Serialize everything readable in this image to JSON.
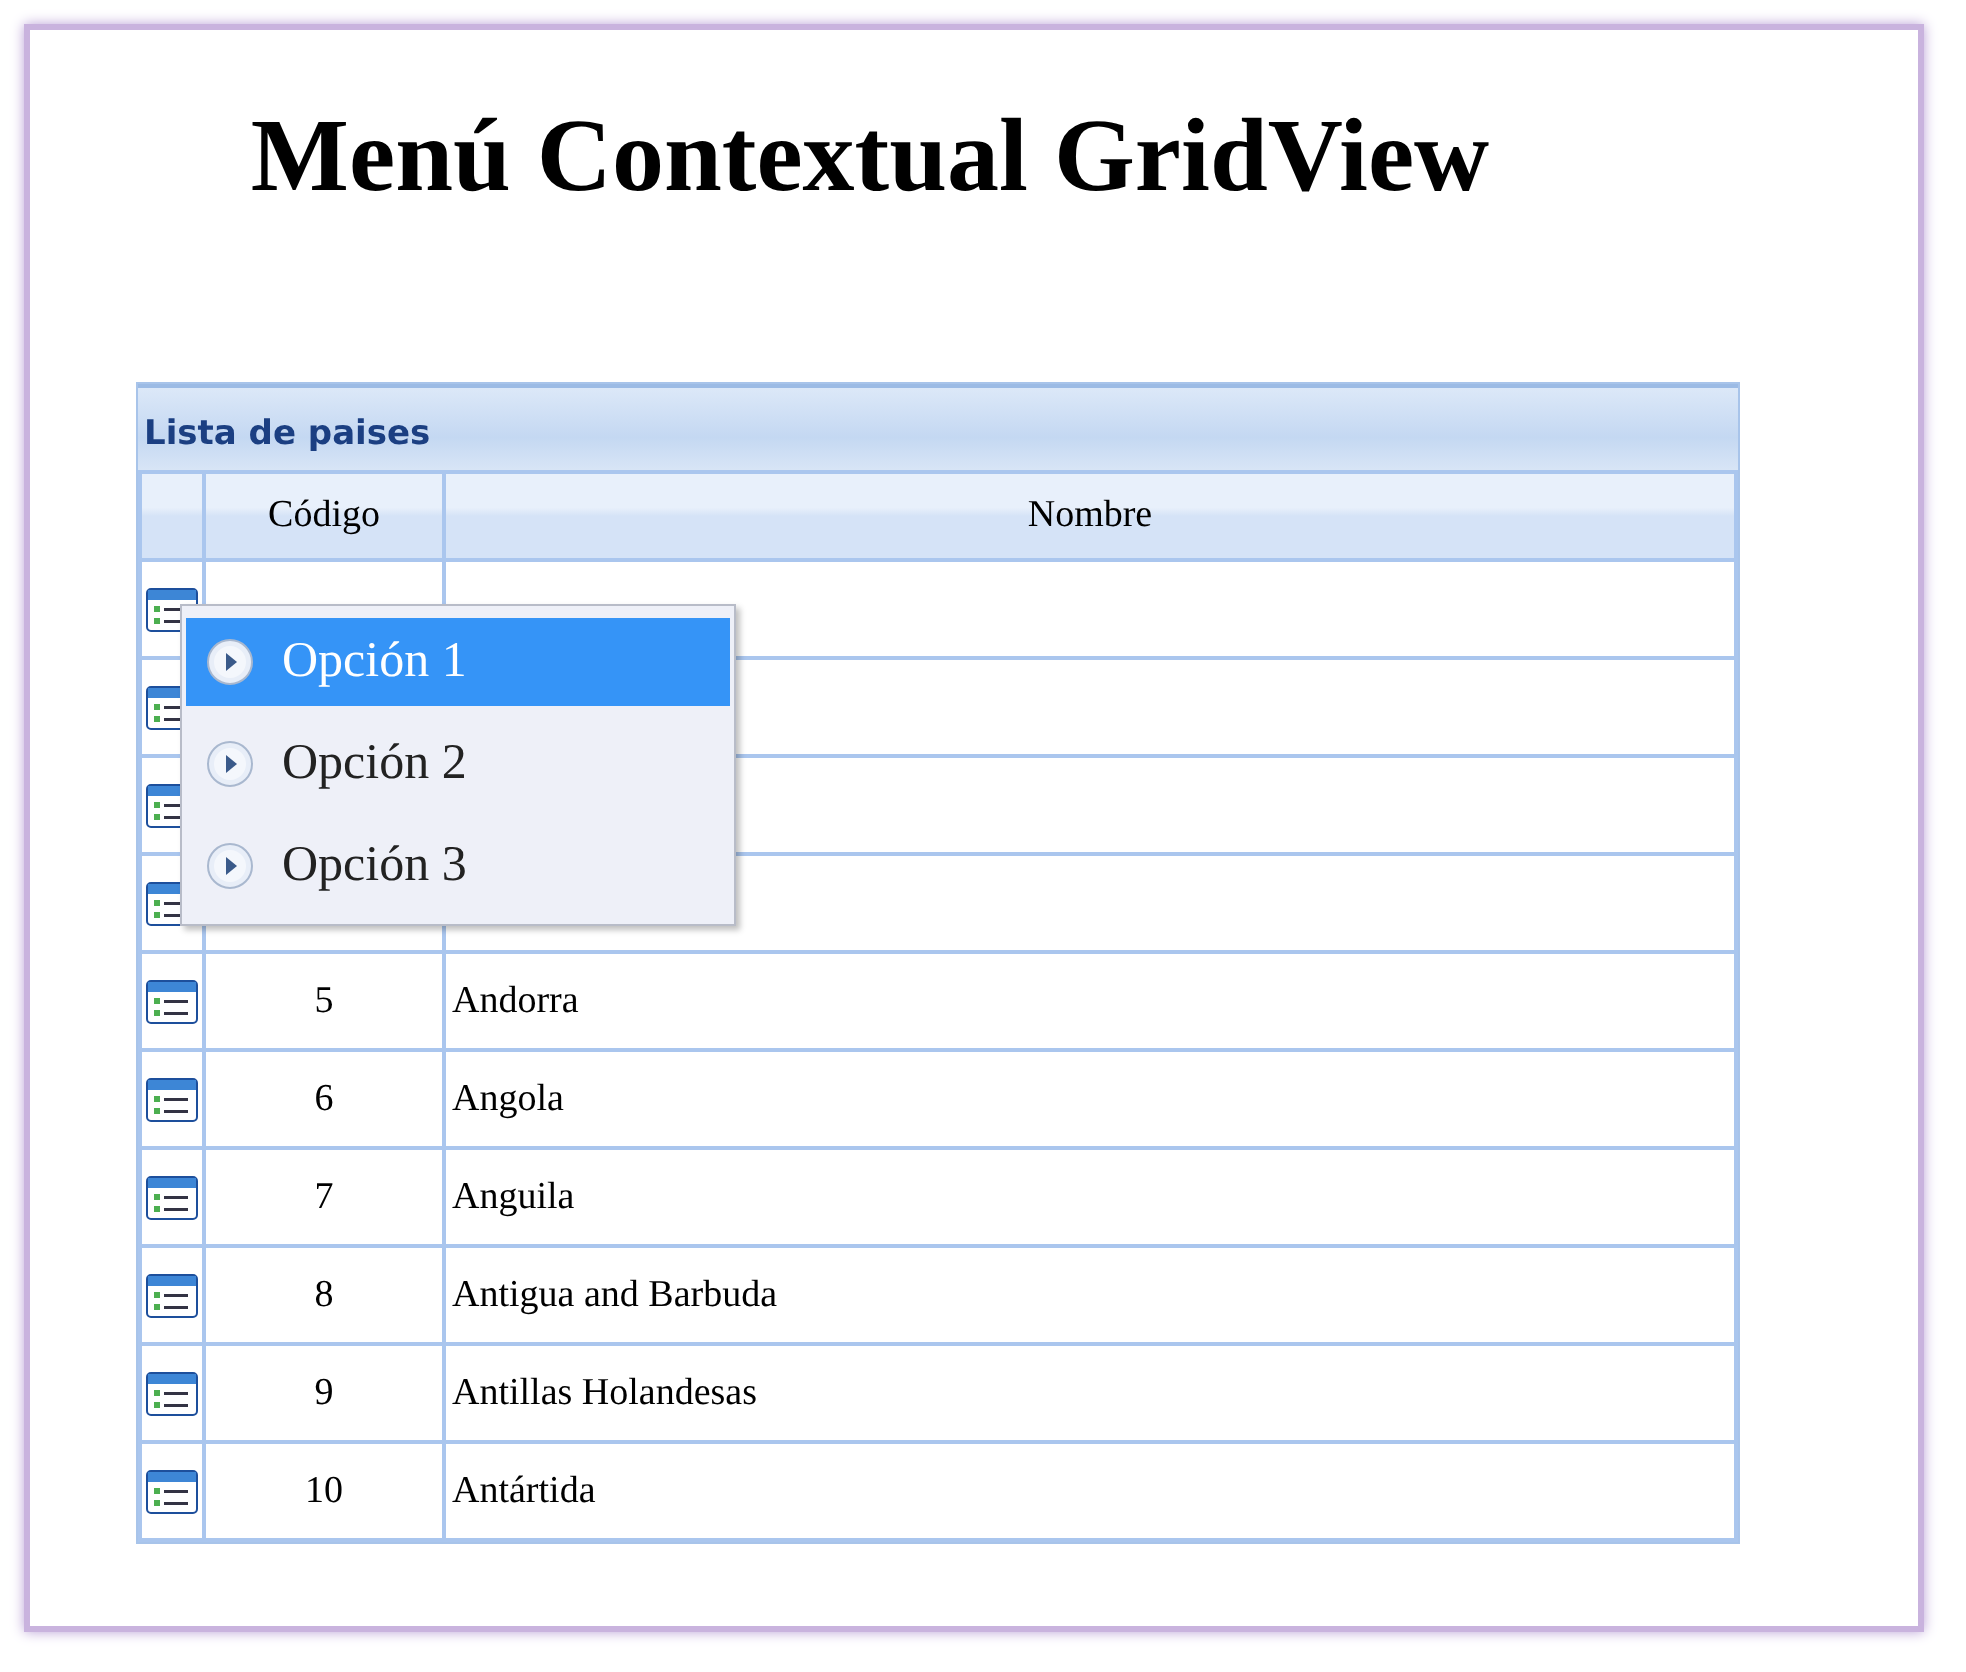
{
  "title": "Menú Contextual GridView",
  "grid": {
    "caption": "Lista de paises",
    "columns": [
      "Código",
      "Nombre"
    ],
    "rows": [
      {},
      {},
      {},
      {},
      {
        "code": "5",
        "name": "Andorra"
      },
      {
        "code": "6",
        "name": "Angola"
      },
      {
        "code": "7",
        "name": "Anguila"
      },
      {
        "code": "8",
        "name": "Antigua and Barbuda"
      },
      {
        "code": "9",
        "name": "Antillas Holandesas"
      },
      {
        "code": "10",
        "name": "Antártida"
      }
    ]
  },
  "context_menu": {
    "items": [
      {
        "label": "Opción 1",
        "selected": true
      },
      {
        "label": "Opción 2",
        "selected": false
      },
      {
        "label": "Opción 3",
        "selected": false
      }
    ]
  }
}
